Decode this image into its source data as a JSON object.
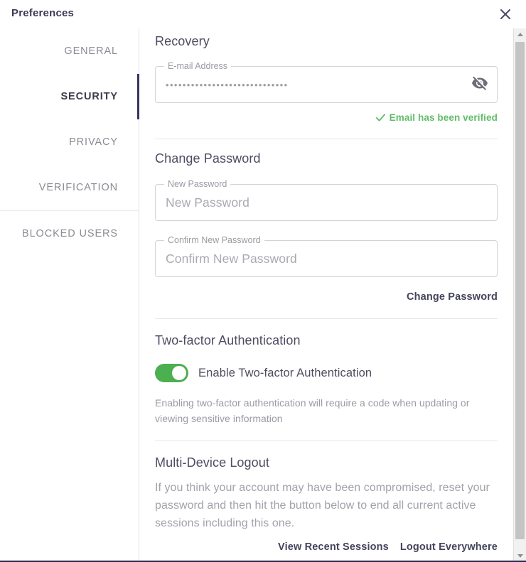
{
  "window": {
    "title": "Preferences",
    "close_icon": "close-icon"
  },
  "sidebar": {
    "items": [
      {
        "label": "GENERAL",
        "active": false,
        "divider_above": false
      },
      {
        "label": "SECURITY",
        "active": true,
        "divider_above": false
      },
      {
        "label": "PRIVACY",
        "active": false,
        "divider_above": false
      },
      {
        "label": "VERIFICATION",
        "active": false,
        "divider_above": false
      },
      {
        "label": "BLOCKED USERS",
        "active": false,
        "divider_above": true
      }
    ]
  },
  "recovery": {
    "heading": "Recovery",
    "email_field": {
      "legend": "E-mail Address",
      "value": "•••••••••••••••••••••••••••••",
      "placeholder": "E-mail Address",
      "toggle_visibility_icon": "eye-off-icon"
    },
    "verified": {
      "icon": "check-icon",
      "text": "Email has been verified",
      "color": "#62bd6a"
    }
  },
  "change_password": {
    "heading": "Change Password",
    "new_password": {
      "legend": "New Password",
      "value": "",
      "placeholder": "New Password"
    },
    "confirm_password": {
      "legend": "Confirm New Password",
      "value": "",
      "placeholder": "Confirm New Password"
    },
    "submit_label": "Change Password"
  },
  "two_factor": {
    "heading": "Two-factor Authentication",
    "toggle": {
      "label": "Enable Two-factor Authentication",
      "enabled": true,
      "on_color": "#4caf50"
    },
    "help_text": "Enabling two-factor authentication will require a code when updating or viewing sensitive information"
  },
  "multi_device_logout": {
    "heading": "Multi-Device Logout",
    "body_text": "If you think your account may have been compromised, reset your password and then hit the button below to end all current active sessions including this one.",
    "view_sessions_label": "View Recent Sessions",
    "logout_everywhere_label": "Logout Everywhere"
  },
  "scrollbar": {
    "up_icon": "caret-up-icon",
    "down_icon": "caret-down-icon"
  }
}
